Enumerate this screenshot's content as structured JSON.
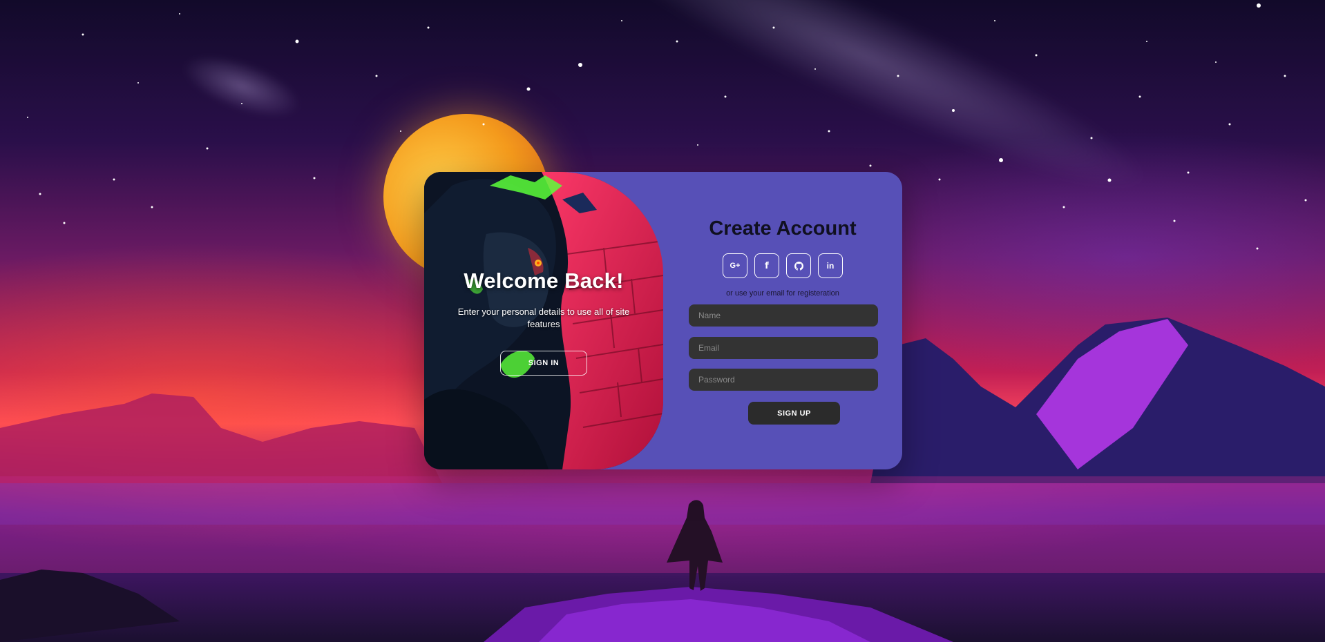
{
  "welcome": {
    "title": "Welcome Back!",
    "subtitle": "Enter your personal details to use all of site features",
    "sign_in_label": "SIGN IN"
  },
  "signup": {
    "title": "Create Account",
    "social": [
      {
        "icon": "google-plus-icon",
        "glyph": "G+"
      },
      {
        "icon": "facebook-icon",
        "glyph": "f"
      },
      {
        "icon": "github-icon",
        "glyph": "github"
      },
      {
        "icon": "linkedin-icon",
        "glyph": "in"
      }
    ],
    "divider_text": "or use your email for registeration",
    "name_placeholder": "Name",
    "email_placeholder": "Email",
    "password_placeholder": "Password",
    "sign_up_label": "SIGN UP"
  },
  "colors": {
    "card_background": "#5750b7",
    "input_background": "#333333",
    "button_background": "#2b2b2b",
    "accent_red": "#d51444",
    "accent_green": "#5cff3a"
  }
}
